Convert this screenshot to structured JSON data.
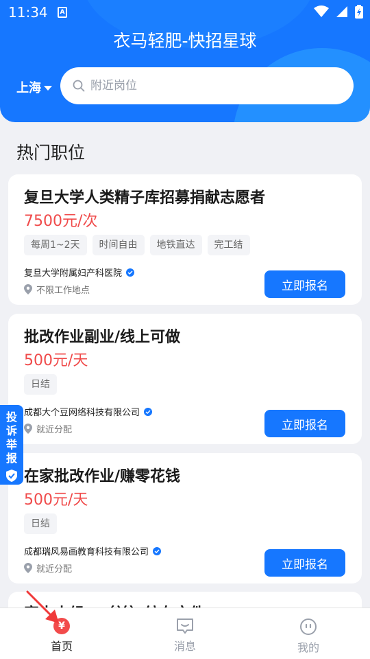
{
  "status": {
    "time": "11:34",
    "sim_label": "A"
  },
  "app": {
    "title": "衣马轻肥-快招星球"
  },
  "location": {
    "city": "上海"
  },
  "search": {
    "placeholder": "附近岗位"
  },
  "section": {
    "title": "热门职位"
  },
  "jobs": [
    {
      "title": "复旦大学人类精子库招募捐献志愿者",
      "pay": "7500元/次",
      "tags": [
        "每周1~2天",
        "时间自由",
        "地铁直达",
        "完工结"
      ],
      "company": "复旦大学附属妇产科医院",
      "location": "不限工作地点",
      "apply_label": "立即报名"
    },
    {
      "title": "批改作业副业/线上可做",
      "pay": "500元/天",
      "tags": [
        "日结"
      ],
      "company": "成都大个豆网络科技有限公司",
      "location": "就近分配",
      "apply_label": "立即报名"
    },
    {
      "title": "在家批改作业/赚零花钱",
      "pay": "500元/天",
      "tags": [
        "日结"
      ],
      "company": "成都瑞风易画教育科技有限公司",
      "location": "就近分配",
      "apply_label": "立即报名"
    },
    {
      "title": "家中小组…（兰）纺布文件"
    }
  ],
  "complain": {
    "chars": [
      "投",
      "诉",
      "举",
      "报"
    ]
  },
  "tabbar": {
    "items": [
      {
        "label": "首页",
        "icon": "yen-icon",
        "symbol": "¥"
      },
      {
        "label": "消息",
        "icon": "message-icon"
      },
      {
        "label": "我的",
        "icon": "profile-icon"
      }
    ]
  },
  "colors": {
    "primary": "#1677ff",
    "price": "#f04b4b",
    "background": "#f0f1f5"
  }
}
